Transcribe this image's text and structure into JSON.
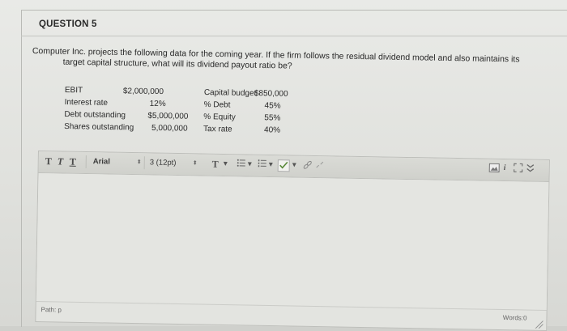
{
  "question": {
    "title": "QUESTION 5",
    "text_line1": "Computer Inc. projects the following data for the coming year.  If the firm follows the residual dividend model and also maintains its",
    "text_line2": "target capital structure, what will its dividend payout ratio be?"
  },
  "data_left": [
    {
      "label": "EBIT",
      "value": "$2,000,000"
    },
    {
      "label": "Interest rate",
      "value": "12%"
    },
    {
      "label": "Debt outstanding",
      "value": "$5,000,000"
    },
    {
      "label": "Shares outstanding",
      "value": "5,000,000"
    }
  ],
  "data_right": [
    {
      "label": "Capital budget",
      "value": "$850,000"
    },
    {
      "label": "% Debt",
      "value": "45%"
    },
    {
      "label": "% Equity",
      "value": "55%"
    },
    {
      "label": "Tax rate",
      "value": "40%"
    }
  ],
  "toolbar": {
    "bold": "T",
    "italic": "T",
    "underline": "T",
    "font_family": "Arial",
    "font_size": "3 (12pt)",
    "text_color": "T",
    "select_arrow": "⬍"
  },
  "status": {
    "path": "Path: p",
    "words": "Words:0"
  },
  "icons": {
    "unordered_list": "bullet-list-icon",
    "ordered_list": "numbered-list-icon",
    "spellcheck": "spellcheck-icon",
    "link": "link-icon",
    "unlink": "unlink-icon",
    "image": "image-icon",
    "html": "html-source-icon",
    "expand": "expand-icon"
  }
}
